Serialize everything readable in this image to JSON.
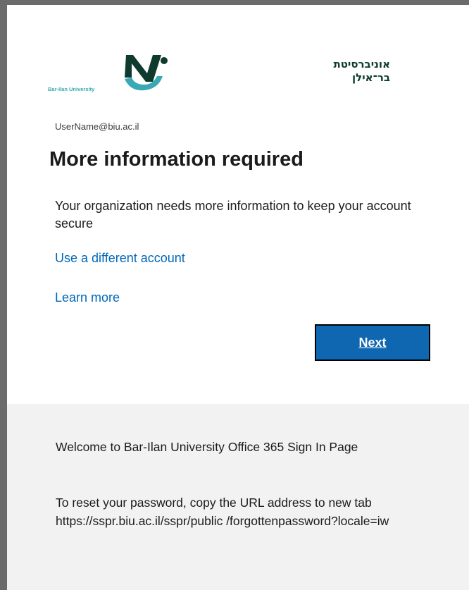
{
  "logo": {
    "hebrew_line1": "אוניברסיטת",
    "hebrew_line2": "בר־אילן",
    "english": "Bar-Ilan University",
    "primary_color": "#0f3b2e",
    "accent_color": "#3aa9b5"
  },
  "account": {
    "username": "UserName@biu.ac.il"
  },
  "main": {
    "title": "More information required",
    "description": "Your organization needs more information to keep your account secure",
    "links": {
      "different_account": "Use a different account",
      "learn_more": "Learn more"
    },
    "next_button_label": "Next"
  },
  "footer": {
    "welcome": "Welcome to Bar-Ilan University Office 365 Sign In Page",
    "reset_instructions": "To reset your password, copy the URL address to new tab https://sspr.biu.ac.il/sspr/public /forgottenpassword?locale=iw"
  },
  "colors": {
    "link": "#0067b8",
    "button": "#0f67b1",
    "footer_background": "#f2f2f2",
    "frame_border": "#6b6b6b"
  }
}
